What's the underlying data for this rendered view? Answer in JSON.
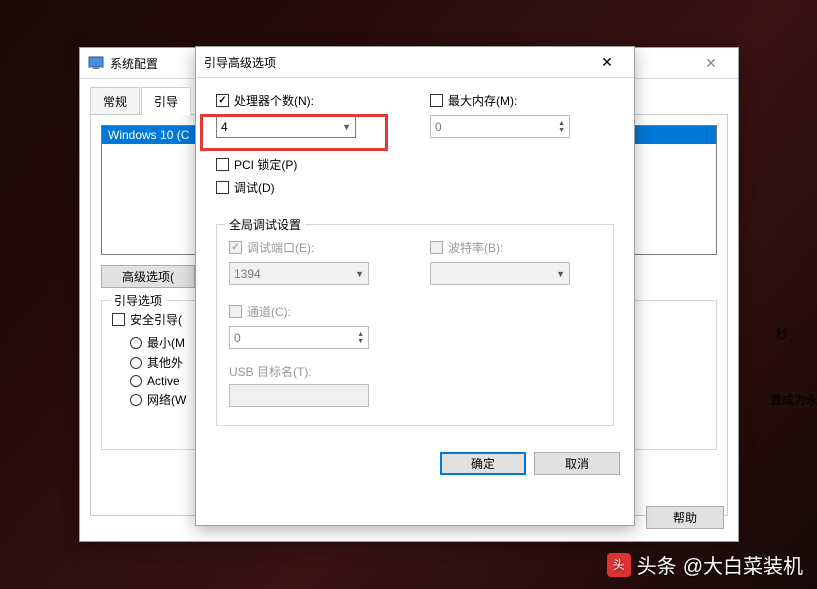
{
  "parent": {
    "title": "系统配置",
    "tabs": [
      "常规",
      "引导"
    ],
    "active_tab": "引导",
    "os_list_item": "Windows 10 (C",
    "advanced_btn": "高级选项(",
    "boot_options_group": "引导选项",
    "safe_boot": "安全引导(",
    "radios": {
      "minimal": "最小(M",
      "altshell": "其他外",
      "active": "Active",
      "network": "网络(W"
    },
    "truncated_text1": "秒",
    "truncated_text2": "置成为永久设置",
    "help_btn": "帮助"
  },
  "dialog": {
    "title": "引导高级选项",
    "processors_label": "处理器个数(N):",
    "processors_value": "4",
    "maxmem_label": "最大内存(M):",
    "maxmem_value": "0",
    "pci_lock": "PCI 锁定(P)",
    "debug": "调试(D)",
    "global_debug_group": "全局调试设置",
    "debug_port_label": "调试端口(E):",
    "debug_port_value": "1394",
    "baud_label": "波特率(B):",
    "baud_value": "",
    "channel_label": "通道(C):",
    "channel_value": "0",
    "usb_target_label": "USB 目标名(T):",
    "ok": "确定",
    "cancel": "取消"
  },
  "watermark": {
    "prefix": "头条",
    "author": "@大白菜装机"
  }
}
